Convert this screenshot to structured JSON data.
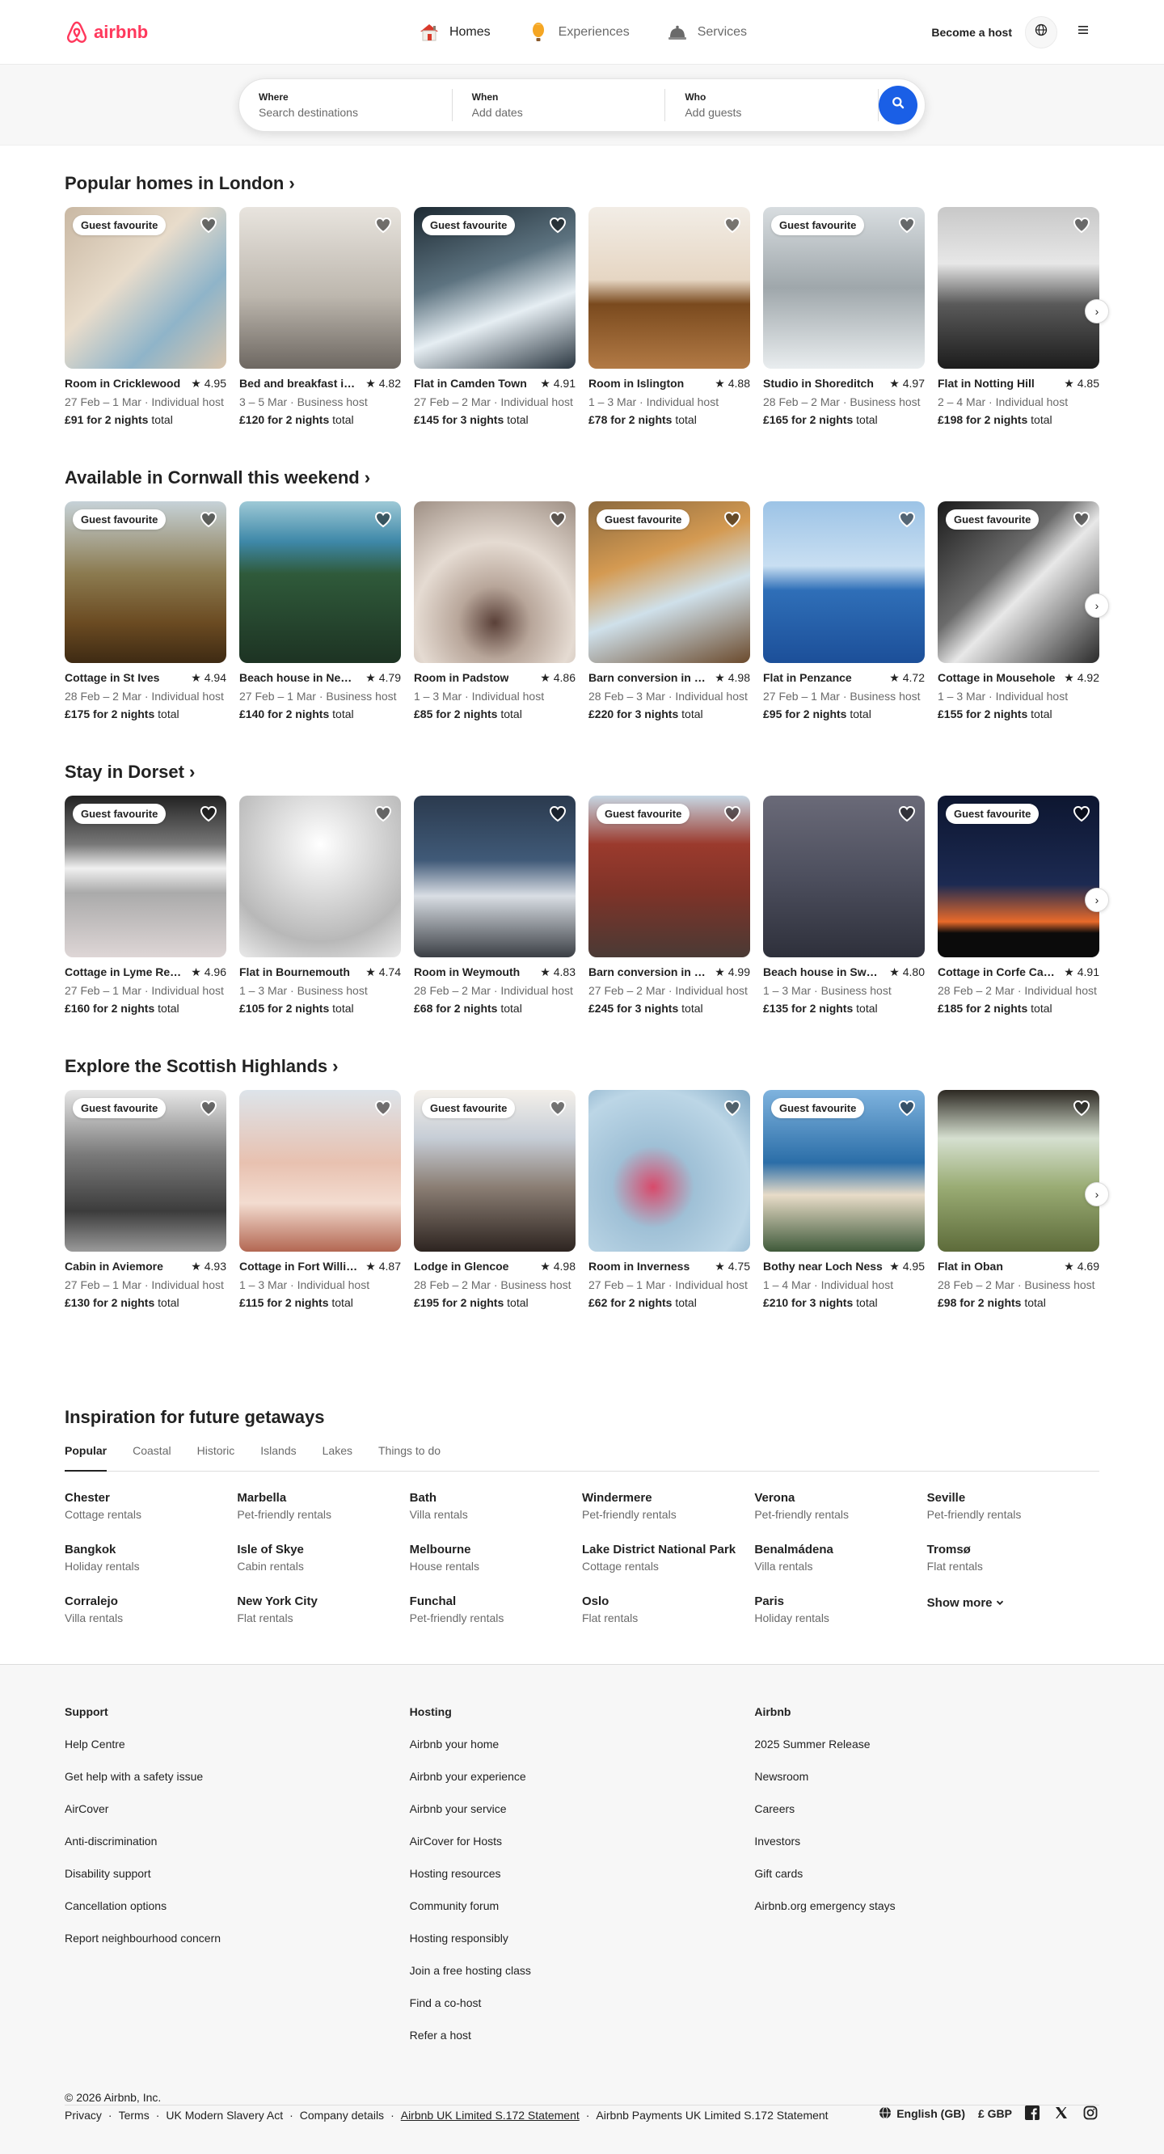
{
  "header": {
    "brand": "airbnb",
    "nav": [
      {
        "label": "Homes",
        "icon": "house-icon",
        "active": true
      },
      {
        "label": "Experiences",
        "icon": "balloon-icon",
        "active": false
      },
      {
        "label": "Services",
        "icon": "bell-icon",
        "active": false
      }
    ],
    "become_host": "Become a host"
  },
  "search": {
    "where_label": "Where",
    "where_placeholder": "Search destinations",
    "when_label": "When",
    "when_placeholder": "Add dates",
    "who_label": "Who",
    "who_placeholder": "Add guests"
  },
  "common": {
    "guest_favourite": "Guest favourite",
    "total_suffix": "total"
  },
  "sections": [
    {
      "title": "Popular homes in London",
      "cards": [
        {
          "title": "Room in Cricklewood",
          "rating": "4.95",
          "sub": "27 Feb – 1 Mar · Individual host",
          "price": "£91 for 2 nights",
          "gf": true
        },
        {
          "title": "Bed and breakfast in Camden",
          "rating": "4.82",
          "sub": "3 – 5 Mar · Business host",
          "price": "£120 for 2 nights",
          "gf": false
        },
        {
          "title": "Flat in Camden Town",
          "rating": "4.91",
          "sub": "27 Feb – 2 Mar · Individual host",
          "price": "£145 for 3 nights",
          "gf": true
        },
        {
          "title": "Room in Islington",
          "rating": "4.88",
          "sub": "1 – 3 Mar · Individual host",
          "price": "£78 for 2 nights",
          "gf": false
        },
        {
          "title": "Studio in Shoreditch",
          "rating": "4.97",
          "sub": "28 Feb – 2 Mar · Business host",
          "price": "£165 for 2 nights",
          "gf": true
        },
        {
          "title": "Flat in Notting Hill",
          "rating": "4.85",
          "sub": "2 – 4 Mar · Individual host",
          "price": "£198 for 2 nights",
          "gf": false
        }
      ]
    },
    {
      "title": "Available in Cornwall this weekend",
      "cards": [
        {
          "title": "Cottage in St Ives",
          "rating": "4.94",
          "sub": "28 Feb – 2 Mar · Individual host",
          "price": "£175 for 2 nights",
          "gf": true
        },
        {
          "title": "Beach house in Newquay",
          "rating": "4.79",
          "sub": "27 Feb – 1 Mar · Business host",
          "price": "£140 for 2 nights",
          "gf": false
        },
        {
          "title": "Room in Padstow",
          "rating": "4.86",
          "sub": "1 – 3 Mar · Individual host",
          "price": "£85 for 2 nights",
          "gf": false
        },
        {
          "title": "Barn conversion in Falmouth",
          "rating": "4.98",
          "sub": "28 Feb – 3 Mar · Individual host",
          "price": "£220 for 3 nights",
          "gf": true
        },
        {
          "title": "Flat in Penzance",
          "rating": "4.72",
          "sub": "27 Feb – 1 Mar · Business host",
          "price": "£95 for 2 nights",
          "gf": false
        },
        {
          "title": "Cottage in Mousehole",
          "rating": "4.92",
          "sub": "1 – 3 Mar · Individual host",
          "price": "£155 for 2 nights",
          "gf": true
        }
      ]
    },
    {
      "title": "Stay in Dorset",
      "cards": [
        {
          "title": "Cottage in Lyme Regis",
          "rating": "4.96",
          "sub": "27 Feb – 1 Mar · Individual host",
          "price": "£160 for 2 nights",
          "gf": true
        },
        {
          "title": "Flat in Bournemouth",
          "rating": "4.74",
          "sub": "1 – 3 Mar · Business host",
          "price": "£105 for 2 nights",
          "gf": false
        },
        {
          "title": "Room in Weymouth",
          "rating": "4.83",
          "sub": "28 Feb – 2 Mar · Individual host",
          "price": "£68 for 2 nights",
          "gf": false
        },
        {
          "title": "Barn conversion in Dorchester",
          "rating": "4.99",
          "sub": "27 Feb – 2 Mar · Individual host",
          "price": "£245 for 3 nights",
          "gf": true
        },
        {
          "title": "Beach house in Swanage",
          "rating": "4.80",
          "sub": "1 – 3 Mar · Business host",
          "price": "£135 for 2 nights",
          "gf": false
        },
        {
          "title": "Cottage in Corfe Castle",
          "rating": "4.91",
          "sub": "28 Feb – 2 Mar · Individual host",
          "price": "£185 for 2 nights",
          "gf": true
        }
      ]
    },
    {
      "title": "Explore the Scottish Highlands",
      "cards": [
        {
          "title": "Cabin in Aviemore",
          "rating": "4.93",
          "sub": "27 Feb – 1 Mar · Individual host",
          "price": "£130 for 2 nights",
          "gf": true
        },
        {
          "title": "Cottage in Fort William",
          "rating": "4.87",
          "sub": "1 – 3 Mar · Individual host",
          "price": "£115 for 2 nights",
          "gf": false
        },
        {
          "title": "Lodge in Glencoe",
          "rating": "4.98",
          "sub": "28 Feb – 2 Mar · Business host",
          "price": "£195 for 2 nights",
          "gf": true
        },
        {
          "title": "Room in Inverness",
          "rating": "4.75",
          "sub": "27 Feb – 1 Mar · Individual host",
          "price": "£62 for 2 nights",
          "gf": false
        },
        {
          "title": "Bothy near Loch Ness",
          "rating": "4.95",
          "sub": "1 – 4 Mar · Individual host",
          "price": "£210 for 3 nights",
          "gf": true
        },
        {
          "title": "Flat in Oban",
          "rating": "4.69",
          "sub": "28 Feb – 2 Mar · Business host",
          "price": "£98 for 2 nights",
          "gf": false
        }
      ]
    }
  ],
  "inspiration": {
    "title": "Inspiration for future getaways",
    "tabs": [
      "Popular",
      "Coastal",
      "Historic",
      "Islands",
      "Lakes",
      "Things to do"
    ],
    "items": [
      {
        "name": "Chester",
        "type": "Cottage rentals"
      },
      {
        "name": "Marbella",
        "type": "Pet-friendly rentals"
      },
      {
        "name": "Bath",
        "type": "Villa rentals"
      },
      {
        "name": "Windermere",
        "type": "Pet-friendly rentals"
      },
      {
        "name": "Verona",
        "type": "Pet-friendly rentals"
      },
      {
        "name": "Seville",
        "type": "Pet-friendly rentals"
      },
      {
        "name": "Bangkok",
        "type": "Holiday rentals"
      },
      {
        "name": "Isle of Skye",
        "type": "Cabin rentals"
      },
      {
        "name": "Melbourne",
        "type": "House rentals"
      },
      {
        "name": "Lake District National Park",
        "type": "Cottage rentals"
      },
      {
        "name": "Benalmádena",
        "type": "Villa rentals"
      },
      {
        "name": "Tromsø",
        "type": "Flat rentals"
      },
      {
        "name": "Corralejo",
        "type": "Villa rentals"
      },
      {
        "name": "New York City",
        "type": "Flat rentals"
      },
      {
        "name": "Funchal",
        "type": "Pet-friendly rentals"
      },
      {
        "name": "Oslo",
        "type": "Flat rentals"
      },
      {
        "name": "Paris",
        "type": "Holiday rentals"
      }
    ],
    "show_more": "Show more"
  },
  "footer": {
    "columns": [
      {
        "title": "Support",
        "links": [
          "Help Centre",
          "Get help with a safety issue",
          "AirCover",
          "Anti-discrimination",
          "Disability support",
          "Cancellation options",
          "Report neighbourhood concern"
        ]
      },
      {
        "title": "Hosting",
        "links": [
          "Airbnb your home",
          "Airbnb your experience",
          "Airbnb your service",
          "AirCover for Hosts",
          "Hosting resources",
          "Community forum",
          "Hosting responsibly",
          "Join a free hosting class",
          "Find a co-host",
          "Refer a host"
        ]
      },
      {
        "title": "Airbnb",
        "links": [
          "2025 Summer Release",
          "Newsroom",
          "Careers",
          "Investors",
          "Gift cards",
          "Airbnb.org emergency stays"
        ]
      }
    ],
    "copyright": "© 2026 Airbnb, Inc.",
    "legal": [
      "Privacy",
      "Terms",
      "UK Modern Slavery Act",
      "Company details",
      "Airbnb UK Limited S.172 Statement",
      "Airbnb Payments UK Limited S.172 Statement"
    ],
    "language": "English (GB)",
    "currency": "£ GBP"
  },
  "colors": {
    "brand": "#ff385c",
    "search_button": "#1a5fe6",
    "text": "#222222",
    "muted": "#6a6a6a"
  }
}
